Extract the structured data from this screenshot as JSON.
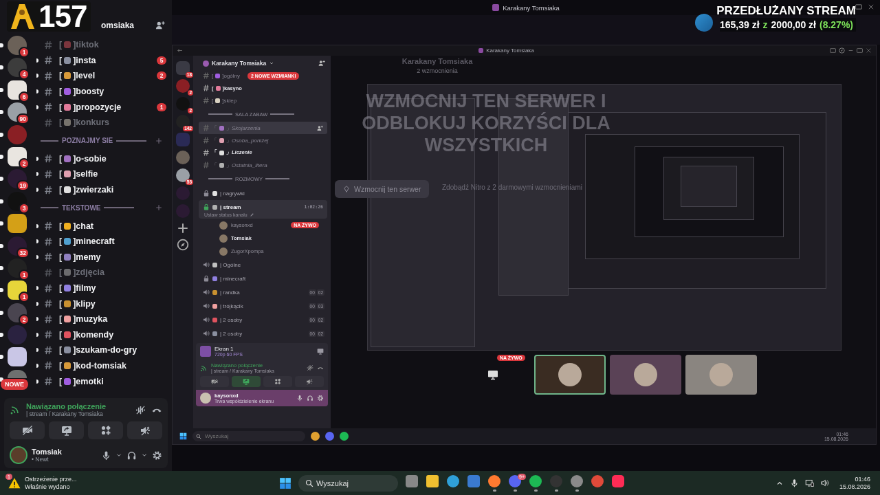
{
  "stream_overlay": {
    "counter": "157",
    "goal_title": "PRZEDŁUŻANY STREAM",
    "raised": "165,39 zł",
    "separator": "z",
    "goal": "2000,00 zł",
    "percent": "(8.27%)"
  },
  "window": {
    "title": "Karakany Tomsiaka"
  },
  "server_list": [
    {
      "badge": "1",
      "unread": true
    },
    {
      "badge": "4",
      "unread": true
    },
    {
      "badge": "6",
      "unread": true
    },
    {
      "badge": "90",
      "unread": true
    },
    {
      "unread": true
    },
    {
      "badge": "2",
      "unread": true
    },
    {
      "badge": "19",
      "unread": true
    },
    {
      "badge": "3",
      "unread": true
    },
    {
      "unread": true
    },
    {
      "badge": "32",
      "unread": true
    },
    {
      "badge": "1",
      "unread": true
    },
    {
      "badge": "1",
      "unread": true
    },
    {
      "badge": "2",
      "unread": true
    },
    {
      "unread": true
    },
    {
      "unread": true
    },
    {
      "unread": true,
      "pill": "NOWE"
    }
  ],
  "server_header": {
    "name": "omsiaka"
  },
  "channels": [
    {
      "kind": "text",
      "prefix": "[",
      "name": "]tiktok",
      "unread": false
    },
    {
      "kind": "text",
      "prefix": "[",
      "name": "]insta",
      "unread": true,
      "badge": "5"
    },
    {
      "kind": "text",
      "prefix": "[",
      "name": "]level",
      "unread": true,
      "badge": "2"
    },
    {
      "kind": "text",
      "prefix": "[",
      "name": "]boosty",
      "unread": true
    },
    {
      "kind": "text",
      "prefix": "[",
      "name": "]propozycje",
      "unread": true,
      "badge": "1"
    },
    {
      "kind": "text",
      "prefix": "[",
      "name": "]konkurs",
      "unread": false
    },
    {
      "kind": "category",
      "name": "POZNAJMY SIE"
    },
    {
      "kind": "text",
      "prefix": "[",
      "name": "]o-sobie",
      "unread": true
    },
    {
      "kind": "text",
      "prefix": "[",
      "name": "]selfie",
      "unread": true
    },
    {
      "kind": "text",
      "prefix": "[",
      "name": "]zwierzaki",
      "unread": true
    },
    {
      "kind": "category",
      "name": "TEKSTOWE"
    },
    {
      "kind": "text",
      "prefix": "[",
      "name": "]chat",
      "unread": true
    },
    {
      "kind": "text",
      "prefix": "[",
      "name": "]minecraft",
      "unread": true
    },
    {
      "kind": "text",
      "prefix": "[",
      "name": "]memy",
      "unread": true
    },
    {
      "kind": "text",
      "prefix": "[",
      "name": "]zdjęcia",
      "unread": false
    },
    {
      "kind": "text",
      "prefix": "[",
      "name": "]filmy",
      "unread": true
    },
    {
      "kind": "text",
      "prefix": "[",
      "name": "]klipy",
      "unread": true
    },
    {
      "kind": "text",
      "prefix": "[",
      "name": "]muzyka",
      "unread": true
    },
    {
      "kind": "text",
      "prefix": "[",
      "name": "]komendy",
      "unread": true
    },
    {
      "kind": "text",
      "prefix": "[",
      "name": "]szukam-do-gry",
      "unread": true
    },
    {
      "kind": "text",
      "prefix": "[",
      "name": "]kod-tomsiak",
      "unread": true
    },
    {
      "kind": "text",
      "prefix": "[",
      "name": "]emotki",
      "unread": true
    }
  ],
  "voice_panel": {
    "status": "Nawiązano połączenie",
    "channel": "| stream / Karakany Tomsiaka"
  },
  "user_panel": {
    "name": "Tomsiak",
    "activity": "• Newt"
  },
  "nested_window": {
    "title": "Karakany Tomsiaka",
    "server_list": [
      {
        "kind": "home",
        "badge": "18"
      },
      {
        "kind": "server",
        "badge": "2"
      },
      {
        "kind": "server",
        "badge": "2"
      },
      {
        "kind": "server",
        "badge": "142"
      },
      {
        "kind": "folder"
      },
      {
        "kind": "server"
      },
      {
        "kind": "server",
        "badge": "53"
      },
      {
        "kind": "server"
      },
      {
        "kind": "server"
      }
    ],
    "server_name": "Karakany Tomsiaka",
    "mentions_pill": "2 NOWE WZMIANKI",
    "channels": [
      {
        "kind": "text",
        "prefix": "[",
        "name": "]ogólny",
        "unread": false,
        "selected": false
      },
      {
        "kind": "text",
        "prefix": "[",
        "name": "]kasyno",
        "unread": true,
        "selected": false
      },
      {
        "kind": "text",
        "prefix": "[",
        "name": "]sklep",
        "unread": false,
        "selected": false
      },
      {
        "kind": "category",
        "name": "SALA ZABAW"
      },
      {
        "kind": "forum",
        "prefix": "「",
        "name": "」Skojarzenia",
        "unread": false,
        "selected": true
      },
      {
        "kind": "forum",
        "prefix": "「",
        "name": "」Osoba_poniżej",
        "unread": false,
        "selected": false
      },
      {
        "kind": "forum",
        "prefix": "「",
        "name": "」Liczenie",
        "unread": true,
        "selected": false
      },
      {
        "kind": "forum",
        "prefix": "「",
        "name": "」Ostatnia_litera",
        "unread": false,
        "selected": false
      },
      {
        "kind": "category",
        "name": "ROZMOWY"
      },
      {
        "kind": "voice",
        "name": "| nagrywki",
        "locked": true,
        "selected": false
      },
      {
        "kind": "voice",
        "name": "| stream",
        "locked": true,
        "selected": true,
        "time": "1:02:26",
        "status": "Ustaw status kanału"
      },
      {
        "kind": "member",
        "name": "kaysonxd",
        "live": "NA ŻYWO"
      },
      {
        "kind": "member",
        "name": "Tomsiak"
      },
      {
        "kind": "member",
        "name": "ZugorXpompa"
      },
      {
        "kind": "voice",
        "name": "| Ogólne",
        "locked": false,
        "selected": false
      },
      {
        "kind": "voice",
        "name": "| minecraft",
        "locked": true,
        "selected": false
      },
      {
        "kind": "voice",
        "name": "| randka",
        "locked": false,
        "selected": false,
        "counts": [
          "00",
          "02"
        ]
      },
      {
        "kind": "voice",
        "name": "| trójkącik",
        "locked": false,
        "selected": false,
        "counts": [
          "00",
          "03"
        ]
      },
      {
        "kind": "voice",
        "name": "| 2 osoby",
        "locked": false,
        "selected": false,
        "counts": [
          "00",
          "02"
        ]
      },
      {
        "kind": "voice",
        "name": "| 2 osoby",
        "locked": false,
        "selected": false,
        "counts": [
          "00",
          "02"
        ]
      }
    ],
    "screen_panel": {
      "title": "Ekran 1",
      "detail": "720p 60 FPS"
    },
    "voice_panel": {
      "status": "Nawiązano połączenie",
      "channel": "| stream / Karakany Tomsiaka"
    },
    "user_panel": {
      "name": "kaysonxd",
      "activity": "Trwa współdzielenie ekranu"
    },
    "main": {
      "server_title": "Karakany Tomsiaka",
      "boosts": "2 wzmocnienia",
      "boost_heading": "WZMOCNIJ TEN SERWER I ODBLOKUJ KORZYŚCI DLA WSZYSTKICH",
      "boost_button": "Wzmocnij ten serwer",
      "nitro_text": "Zdobądź Nitro z 2 darmowymi wzmocnieniami",
      "live_badge": "NA ŻYWO",
      "tiles": [
        {
          "selected": true
        },
        {
          "selected": false
        },
        {
          "selected": false
        }
      ]
    },
    "taskbar": {
      "search_placeholder": "Wyszukaj",
      "apps": [
        {
          "kind": "chrome"
        },
        {
          "kind": "discord"
        },
        {
          "kind": "spotify"
        }
      ],
      "time": "01:46",
      "date": "15.08.2026"
    }
  },
  "taskbar": {
    "notification": {
      "title": "Ostrzeżenie prze...",
      "subtitle": "Właśnie wydano",
      "badge": "1"
    },
    "search_placeholder": "Wyszukaj",
    "apps": [
      {
        "kind": "taskview",
        "running": false
      },
      {
        "kind": "folder",
        "running": false
      },
      {
        "kind": "edge",
        "running": false
      },
      {
        "kind": "store",
        "running": false
      },
      {
        "kind": "firefox",
        "running": true
      },
      {
        "kind": "discord",
        "running": true,
        "badge": "9+"
      },
      {
        "kind": "spotify",
        "running": true
      },
      {
        "kind": "obs",
        "running": true
      },
      {
        "kind": "settings",
        "running": true
      },
      {
        "kind": "chrome",
        "running": false
      },
      {
        "kind": "tiktok",
        "running": false
      }
    ],
    "time": "01:46",
    "date": "15.08.2026"
  }
}
